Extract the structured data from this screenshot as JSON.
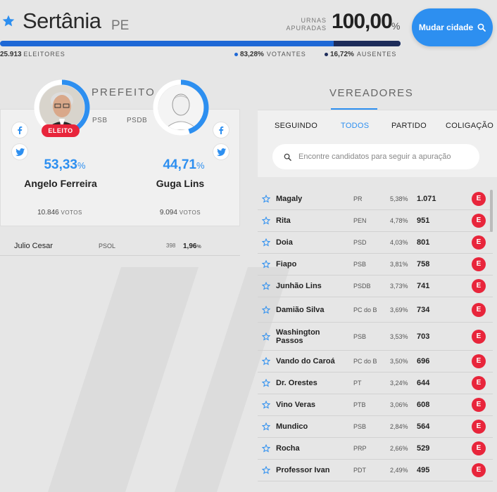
{
  "header": {
    "city": "Sertânia",
    "uf": "PE",
    "urnas_label": "URNAS APURADAS",
    "apuradas_pct": "100,00",
    "pct_sign": "%",
    "mudar_label": "Mudar cidade",
    "eleitores_count": "25.913",
    "eleitores_label": "ELEITORES",
    "votantes_pct": "83,28%",
    "votantes_label": "VOTANTES",
    "ausentes_pct": "16,72%",
    "ausentes_label": "AUSENTES",
    "votantes_fraction": 0.8328,
    "bar_color": "#1e68d6",
    "absent_color": "#1d2c5a"
  },
  "prefeito": {
    "title": "PREFEITO",
    "eleito_label": "ELEITO",
    "candidates": [
      {
        "name": "Angelo Ferreira",
        "party": "PSB",
        "pct": "53,33",
        "pct_sign": "%",
        "votes": "10.846",
        "votes_label": "VOTOS",
        "ring_fraction": 0.5333
      },
      {
        "name": "Guga Lins",
        "party": "PSDB",
        "pct": "44,71",
        "pct_sign": "%",
        "votes": "9.094",
        "votes_label": "VOTOS",
        "ring_fraction": 0.4471
      }
    ],
    "others": [
      {
        "name": "Julio Cesar",
        "party": "PSOL",
        "votes": "398",
        "pct": "1,96",
        "pct_sign": "%"
      }
    ]
  },
  "vereadores": {
    "title": "VEREADORES",
    "tabs": [
      "SEGUINDO",
      "TODOS",
      "PARTIDO",
      "COLIGAÇÃO"
    ],
    "active_tab": "TODOS",
    "search_placeholder": "Encontre candidatos para seguir a apuração",
    "elected_badge": "E",
    "rows": [
      {
        "name": "Magaly",
        "party": "PR",
        "pct": "5,38%",
        "votes": "1.071"
      },
      {
        "name": "Rita",
        "party": "PEN",
        "pct": "4,78%",
        "votes": "951"
      },
      {
        "name": "Doia",
        "party": "PSD",
        "pct": "4,03%",
        "votes": "801"
      },
      {
        "name": "Fiapo",
        "party": "PSB",
        "pct": "3,81%",
        "votes": "758"
      },
      {
        "name": "Junhão Lins",
        "party": "PSDB",
        "pct": "3,73%",
        "votes": "741"
      },
      {
        "name": "Damião Silva",
        "party": "PC do B",
        "pct": "3,69%",
        "votes": "734"
      },
      {
        "name": "Washington Passos",
        "party": "PSB",
        "pct": "3,53%",
        "votes": "703"
      },
      {
        "name": "Vando do Caroá",
        "party": "PC do B",
        "pct": "3,50%",
        "votes": "696"
      },
      {
        "name": "Dr. Orestes",
        "party": "PT",
        "pct": "3,24%",
        "votes": "644"
      },
      {
        "name": "Vino Veras",
        "party": "PTB",
        "pct": "3,06%",
        "votes": "608"
      },
      {
        "name": "Mundico",
        "party": "PSB",
        "pct": "2,84%",
        "votes": "564"
      },
      {
        "name": "Rocha",
        "party": "PRP",
        "pct": "2,66%",
        "votes": "529"
      },
      {
        "name": "Professor Ivan",
        "party": "PDT",
        "pct": "2,49%",
        "votes": "495"
      }
    ]
  },
  "colors": {
    "accent": "#2d8ff0",
    "elected": "#e8253b"
  },
  "icons": [
    "star-icon",
    "search-icon",
    "facebook-icon",
    "twitter-icon"
  ]
}
